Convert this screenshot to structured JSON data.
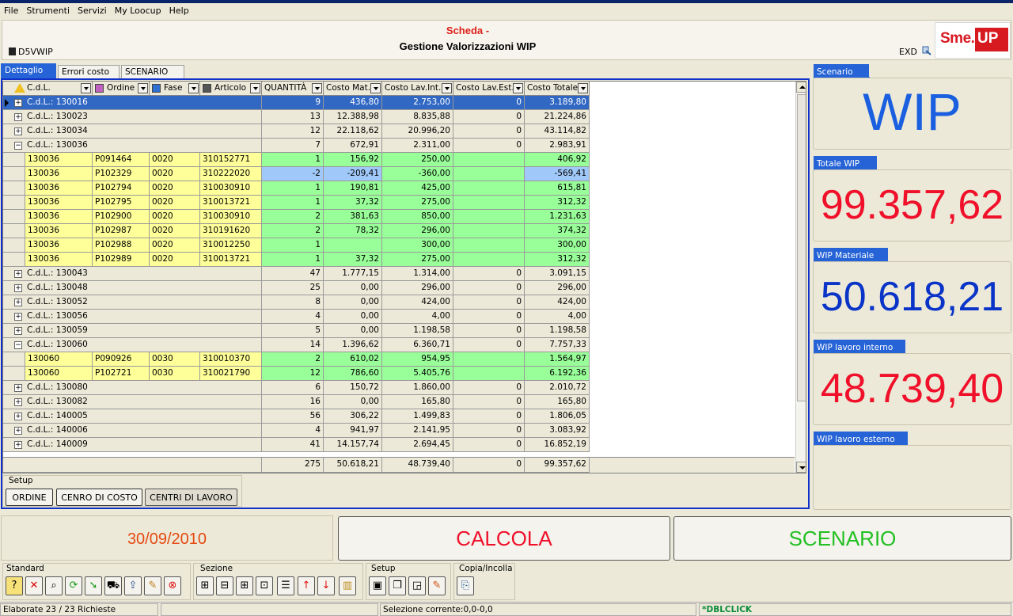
{
  "menu": [
    "File",
    "Strumenti",
    "Servizi",
    "My Loocup",
    "Help"
  ],
  "header": {
    "title": "Scheda -",
    "subtitle": "Gestione Valorizzazioni WIP",
    "code": "D5VWIP",
    "exd": "EXD",
    "logo_left": "Sme.",
    "logo_right": "UP"
  },
  "tabs": [
    "Dettaglio",
    "Errori costo",
    "SCENARIO"
  ],
  "grid": {
    "columns": [
      "C.d.L.",
      "Ordine",
      "Fase",
      "Articolo",
      "QUANTITÀ",
      "Costo Mat.",
      "Costo Lav.Int.",
      "Costo Lav.Est.",
      "Costo Totale"
    ],
    "rows": [
      {
        "t": "g",
        "sel": true,
        "exp": "+",
        "label": "C.d.L.: 130016",
        "q": "9",
        "m": "436,80",
        "li": "2.753,00",
        "le": "0",
        "tot": "3.189,80"
      },
      {
        "t": "g",
        "exp": "+",
        "label": "C.d.L.: 130023",
        "q": "13",
        "m": "12.388,98",
        "li": "8.835,88",
        "le": "0",
        "tot": "21.224,86"
      },
      {
        "t": "g",
        "exp": "+",
        "label": "C.d.L.: 130034",
        "q": "12",
        "m": "22.118,62",
        "li": "20.996,20",
        "le": "0",
        "tot": "43.114,82"
      },
      {
        "t": "g",
        "exp": "−",
        "label": "C.d.L.: 130036",
        "q": "7",
        "m": "672,91",
        "li": "2.311,00",
        "le": "0",
        "tot": "2.983,91"
      },
      {
        "t": "d",
        "cdl": "130036",
        "ord": "P091464",
        "fase": "0020",
        "art": "310152771",
        "q": "1",
        "m": "156,92",
        "li": "250,00",
        "le": "",
        "tot": "406,92"
      },
      {
        "t": "d",
        "neg": true,
        "cdl": "130036",
        "ord": "P102329",
        "fase": "0020",
        "art": "310222020",
        "q": "-2",
        "m": "-209,41",
        "li": "-360,00",
        "le": "",
        "tot": "-569,41"
      },
      {
        "t": "d",
        "cdl": "130036",
        "ord": "P102794",
        "fase": "0020",
        "art": "310030910",
        "q": "1",
        "m": "190,81",
        "li": "425,00",
        "le": "",
        "tot": "615,81"
      },
      {
        "t": "d",
        "cdl": "130036",
        "ord": "P102795",
        "fase": "0020",
        "art": "310013721",
        "q": "1",
        "m": "37,32",
        "li": "275,00",
        "le": "",
        "tot": "312,32"
      },
      {
        "t": "d",
        "cdl": "130036",
        "ord": "P102900",
        "fase": "0020",
        "art": "310030910",
        "q": "2",
        "m": "381,63",
        "li": "850,00",
        "le": "",
        "tot": "1.231,63"
      },
      {
        "t": "d",
        "cdl": "130036",
        "ord": "P102987",
        "fase": "0020",
        "art": "310191620",
        "q": "2",
        "m": "78,32",
        "li": "296,00",
        "le": "",
        "tot": "374,32"
      },
      {
        "t": "d",
        "cdl": "130036",
        "ord": "P102988",
        "fase": "0020",
        "art": "310012250",
        "q": "1",
        "m": "",
        "li": "300,00",
        "le": "",
        "tot": "300,00"
      },
      {
        "t": "d",
        "cdl": "130036",
        "ord": "P102989",
        "fase": "0020",
        "art": "310013721",
        "q": "1",
        "m": "37,32",
        "li": "275,00",
        "le": "",
        "tot": "312,32"
      },
      {
        "t": "g",
        "exp": "+",
        "label": "C.d.L.: 130043",
        "q": "47",
        "m": "1.777,15",
        "li": "1.314,00",
        "le": "0",
        "tot": "3.091,15"
      },
      {
        "t": "g",
        "exp": "+",
        "label": "C.d.L.: 130048",
        "q": "25",
        "m": "0,00",
        "li": "296,00",
        "le": "0",
        "tot": "296,00"
      },
      {
        "t": "g",
        "exp": "+",
        "label": "C.d.L.: 130052",
        "q": "8",
        "m": "0,00",
        "li": "424,00",
        "le": "0",
        "tot": "424,00"
      },
      {
        "t": "g",
        "exp": "+",
        "label": "C.d.L.: 130056",
        "q": "4",
        "m": "0,00",
        "li": "4,00",
        "le": "0",
        "tot": "4,00"
      },
      {
        "t": "g",
        "exp": "+",
        "label": "C.d.L.: 130059",
        "q": "5",
        "m": "0,00",
        "li": "1.198,58",
        "le": "0",
        "tot": "1.198,58"
      },
      {
        "t": "g",
        "exp": "−",
        "label": "C.d.L.: 130060",
        "q": "14",
        "m": "1.396,62",
        "li": "6.360,71",
        "le": "0",
        "tot": "7.757,33"
      },
      {
        "t": "d",
        "cdl": "130060",
        "ord": "P090926",
        "fase": "0030",
        "art": "310010370",
        "q": "2",
        "m": "610,02",
        "li": "954,95",
        "le": "",
        "tot": "1.564,97"
      },
      {
        "t": "d",
        "cdl": "130060",
        "ord": "P102721",
        "fase": "0030",
        "art": "310021790",
        "q": "12",
        "m": "786,60",
        "li": "5.405,76",
        "le": "",
        "tot": "6.192,36"
      },
      {
        "t": "g",
        "exp": "+",
        "label": "C.d.L.: 130080",
        "q": "6",
        "m": "150,72",
        "li": "1.860,00",
        "le": "0",
        "tot": "2.010,72"
      },
      {
        "t": "g",
        "exp": "+",
        "label": "C.d.L.: 130082",
        "q": "16",
        "m": "0,00",
        "li": "165,80",
        "le": "0",
        "tot": "165,80"
      },
      {
        "t": "g",
        "exp": "+",
        "label": "C.d.L.: 140005",
        "q": "56",
        "m": "306,22",
        "li": "1.499,83",
        "le": "0",
        "tot": "1.806,05"
      },
      {
        "t": "g",
        "exp": "+",
        "label": "C.d.L.: 140006",
        "q": "4",
        "m": "941,97",
        "li": "2.141,95",
        "le": "0",
        "tot": "3.083,92"
      },
      {
        "t": "g",
        "exp": "+",
        "label": "C.d.L.: 140009",
        "q": "41",
        "m": "14.157,74",
        "li": "2.694,45",
        "le": "0",
        "tot": "16.852,19"
      }
    ],
    "totals": {
      "q": "275",
      "m": "50.618,21",
      "li": "48.739,40",
      "le": "0",
      "tot": "99.357,62"
    }
  },
  "setup": {
    "legend": "Setup",
    "buttons": [
      "ORDINE",
      "CENRO DI COSTO",
      "CENTRI DI LAVORO"
    ]
  },
  "panels": [
    {
      "label": "Scenario",
      "value": "WIP",
      "color": "#1a5fe0"
    },
    {
      "label": "Totale WIP",
      "value": "99.357,62",
      "color": "#f0102a"
    },
    {
      "label": "WIP Materiale",
      "value": "50.618,21",
      "color": "#0a34c8"
    },
    {
      "label": "WIP lavoro interno",
      "value": "48.739,40",
      "color": "#f0102a"
    },
    {
      "label": "WIP lavoro esterno",
      "value": "",
      "color": "#0a34c8"
    }
  ],
  "date": "30/09/2010",
  "actions": {
    "calcola": "CALCOLA",
    "scenario": "SCENARIO"
  },
  "toolbar": {
    "standard": "Standard",
    "sezione": "Sezione",
    "setup": "Setup",
    "copia": "Copia/Incolla"
  },
  "status": {
    "s1": "Elaborate 23 / 23 Richieste",
    "s2": "Selezione corrente:0,0-0,0",
    "s3": "*DBLCLICK"
  }
}
